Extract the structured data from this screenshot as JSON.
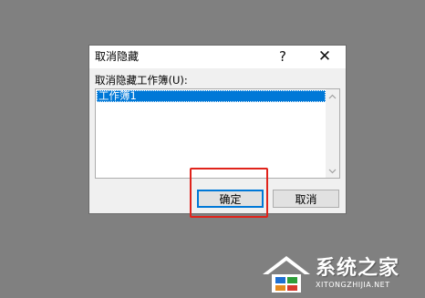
{
  "dialog": {
    "title": "取消隐藏",
    "help_label": "?",
    "close_label": "✕",
    "list_label": "取消隐藏工作簿(U):",
    "list_items": [
      "工作簿1"
    ],
    "ok_label": "确定",
    "cancel_label": "取消"
  },
  "annotation": {
    "highlight_color": "#e0231b"
  },
  "watermark": {
    "title": "系统之家",
    "url": "XITONGZHIJIA.NET"
  },
  "colors": {
    "background": "#808080",
    "selection": "#0078d7",
    "dialog_face": "#f0f0f0"
  }
}
